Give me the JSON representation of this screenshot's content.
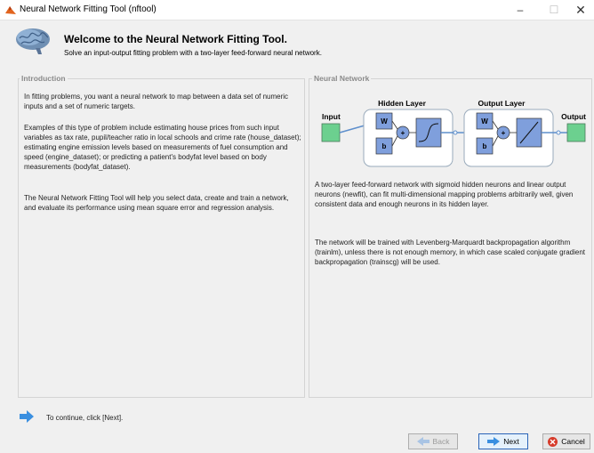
{
  "window": {
    "title": "Neural Network Fitting Tool (nftool)"
  },
  "header": {
    "title": "Welcome to the Neural Network Fitting Tool.",
    "subtitle": "Solve an input-output fitting problem with a two-layer feed-forward neural network."
  },
  "introduction": {
    "heading": "Introduction",
    "p1": "In fitting problems, you want a neural network to map between a data set of numeric inputs and a set of numeric targets.",
    "p2": "Examples of this type of problem include estimating house prices from such input variables as tax rate, pupil/teacher ratio in local schools and crime rate (house_dataset); estimating engine emission levels based on measurements of fuel consumption and speed (engine_dataset); or predicting a patient's bodyfat level based on body measurements (bodyfat_dataset).",
    "p3": "The Neural Network Fitting Tool will help you select data, create and train a network, and evaluate its performance using mean square error and regression analysis."
  },
  "network": {
    "heading": "Neural Network",
    "diagram": {
      "input_label": "Input",
      "hidden_label": "Hidden Layer",
      "output_layer_label": "Output Layer",
      "output_label": "Output",
      "weight": "W",
      "bias": "b",
      "sum": "+"
    },
    "p1": "A two-layer feed-forward network with sigmoid hidden neurons and linear output neurons (newfit), can fit multi-dimensional mapping problems arbitrarily well, given consistent data and enough neurons in its hidden layer.",
    "p2": "The network will be trained with Levenberg-Marquardt backpropagation algorithm (trainlm), unless there is not enough memory, in which case scaled conjugate gradient backpropagation (trainscg) will be used."
  },
  "footer": {
    "continue_text": "To continue, click [Next].",
    "back_label": "Back",
    "next_label": "Next",
    "cancel_label": "Cancel"
  },
  "colors": {
    "block_fill": "#7f9fdc",
    "io_fill": "#6cd08f",
    "next_border": "#2a64b8",
    "cancel_icon": "#d63b2a",
    "arrow_icon": "#3a8fe0"
  }
}
